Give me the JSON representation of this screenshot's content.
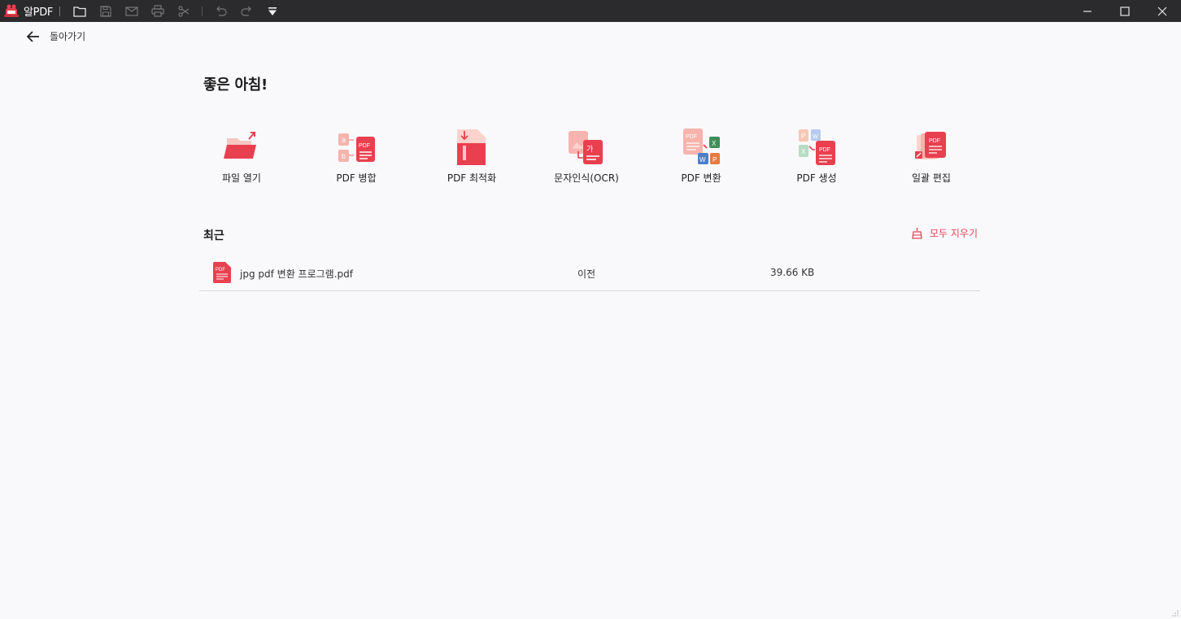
{
  "app": {
    "name": "알PDF"
  },
  "toolbar": {
    "icons": [
      "folder-icon",
      "save-icon",
      "mail-icon",
      "print-icon",
      "scissors-icon",
      "undo-icon",
      "redo-icon",
      "dropdown-icon"
    ]
  },
  "window_controls": [
    "minimize-icon",
    "maximize-icon",
    "close-icon"
  ],
  "back": {
    "label": "돌아가기"
  },
  "greeting": "좋은 아침!",
  "tools": [
    {
      "label": "파일 열기",
      "icon": "open-file-icon"
    },
    {
      "label": "PDF 병합",
      "icon": "pdf-merge-icon"
    },
    {
      "label": "PDF 최적화",
      "icon": "pdf-optimize-icon"
    },
    {
      "label": "문자인식(OCR)",
      "icon": "ocr-icon"
    },
    {
      "label": "PDF 변환",
      "icon": "pdf-convert-icon"
    },
    {
      "label": "PDF 생성",
      "icon": "pdf-create-icon"
    },
    {
      "label": "일괄 편집",
      "icon": "batch-edit-icon"
    }
  ],
  "recent": {
    "title": "최근",
    "clear_label": "모두 지우기",
    "files": [
      {
        "name": "jpg pdf 변환 프로그램.pdf",
        "location": "이전",
        "size": "39.66 KB"
      }
    ]
  },
  "colors": {
    "accent": "#e8404f",
    "accent_light": "#f7b3ad",
    "titlebar": "#2b2b2e",
    "background": "#f9f9fb"
  }
}
